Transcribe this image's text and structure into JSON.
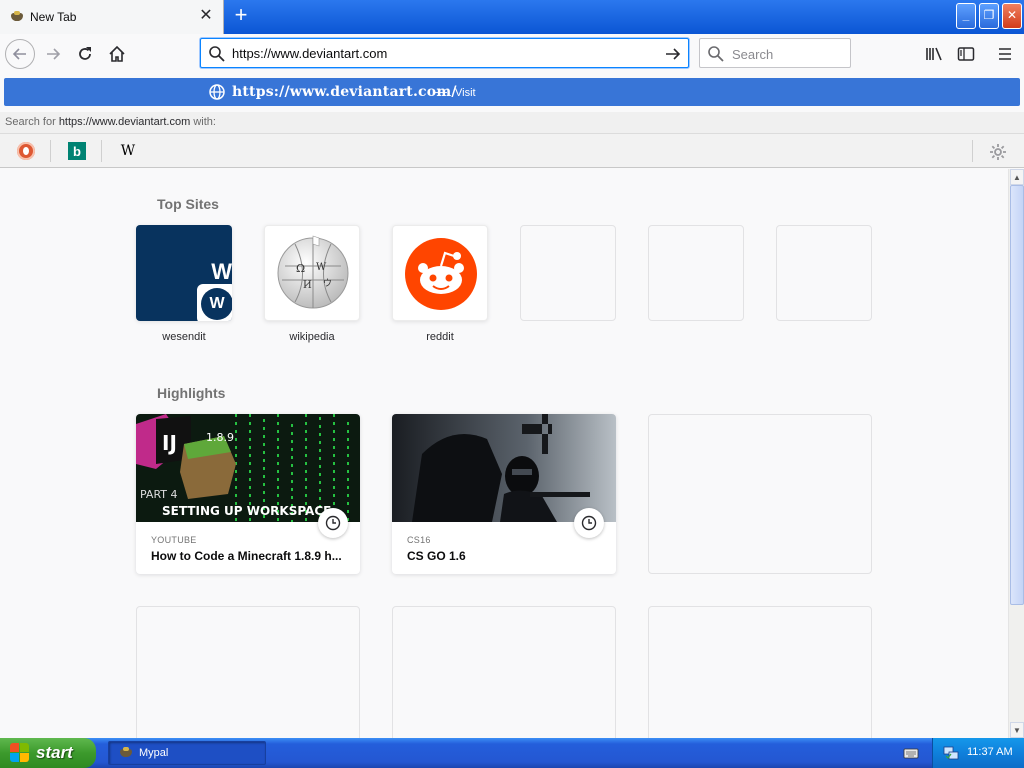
{
  "tab": {
    "title": "New Tab"
  },
  "urlbar": {
    "value": "https://www.deviantart.com"
  },
  "searchbar": {
    "placeholder": "Search"
  },
  "popup": {
    "url": "https://www.deviantart.com/",
    "separator": "—",
    "action": "Visit",
    "search_for_prefix": "Search for",
    "search_for_query": "https://www.deviantart.com",
    "search_for_suffix": "with:"
  },
  "search_engines": [
    {
      "name": "duckduckgo",
      "icon": "duckduckgo-icon"
    },
    {
      "name": "bing",
      "icon": "bing-icon",
      "glyph": "b"
    },
    {
      "name": "wikipedia",
      "icon": "wikipedia-icon",
      "glyph": "W"
    }
  ],
  "top_sites": {
    "title": "Top Sites",
    "items": [
      {
        "label": "wesendit",
        "icon_letter": "W"
      },
      {
        "label": "wikipedia"
      },
      {
        "label": "reddit"
      }
    ]
  },
  "highlights": {
    "title": "Highlights",
    "items": [
      {
        "source": "YOUTUBE",
        "title": "How to Code a Minecraft 1.8.9 h...",
        "thumb_text_1": "1.8.9",
        "thumb_text_2": "PART 4",
        "thumb_text_3": "SETTING UP WORKSPACE",
        "thumb_badge": "IJ"
      },
      {
        "source": "CS16",
        "title": "CS GO 1.6"
      }
    ]
  },
  "taskbar": {
    "start_label": "start",
    "window_label": "Mypal",
    "clock": "11:37 AM"
  },
  "colors": {
    "accent": "#0a84ff",
    "popup_highlight": "#3875d7",
    "wesendit_blue": "#08335e",
    "reddit_orange": "#ff4500"
  }
}
